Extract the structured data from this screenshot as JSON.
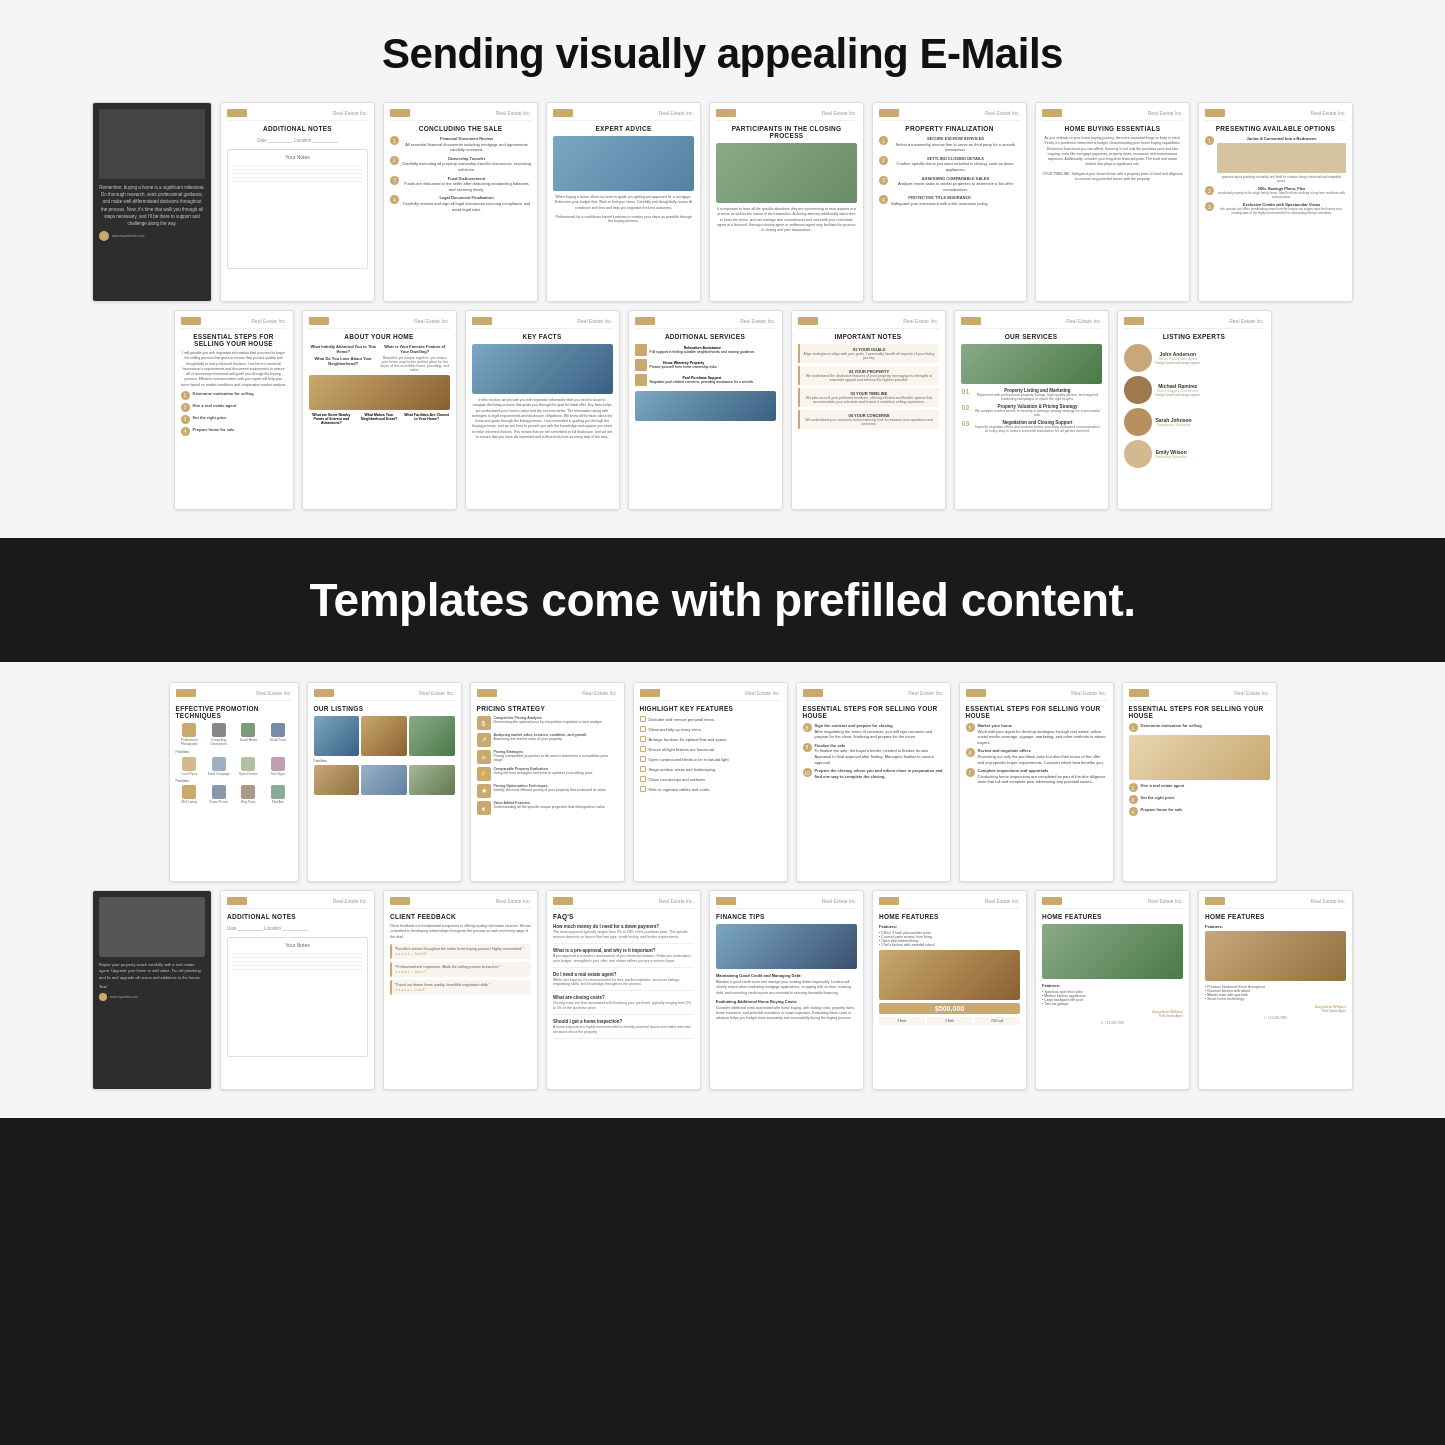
{
  "hero": {
    "title": "Sending visually appealing E-Mails"
  },
  "mid_banner": {
    "title": "Templates come with prefilled content."
  },
  "row1": {
    "cards": [
      {
        "id": "additional-notes-1",
        "title": "ADDITIONAL NOTES",
        "type": "notes"
      },
      {
        "id": "concluding-sale",
        "title": "CONCLUDING THE SALE",
        "type": "numbered"
      },
      {
        "id": "expert-advice",
        "title": "EXPERT ADVICE",
        "type": "text-image"
      },
      {
        "id": "participants-closing",
        "title": "PARTICIPANTS IN THE CLOSING PROCESS",
        "type": "text-image"
      },
      {
        "id": "property-finalization",
        "title": "PROPERTY FINALIZATION",
        "type": "numbered"
      },
      {
        "id": "home-buying-essentials",
        "title": "HOME BUYING ESSENTIALS",
        "type": "text-image"
      },
      {
        "id": "presenting-available",
        "title": "PRESENTING AVAILABLE OPTIONS",
        "type": "numbered"
      },
      {
        "id": "dark-intro",
        "title": "",
        "type": "dark-text"
      }
    ]
  },
  "row2": {
    "cards": [
      {
        "id": "essential-steps-1",
        "title": "ESSENTIAL STEPS FOR SELLING YOUR HOUSE",
        "type": "numbered"
      },
      {
        "id": "about-home",
        "title": "ABOUT YOUR HOME",
        "type": "about"
      },
      {
        "id": "key-facts",
        "title": "KEY FACTS",
        "type": "image-text"
      },
      {
        "id": "additional-services",
        "title": "ADDITIONAL SERVICES",
        "type": "services-list"
      },
      {
        "id": "important-notes",
        "title": "IMPORTANT NOTES",
        "type": "important"
      },
      {
        "id": "our-services",
        "title": "OUR SERVICES",
        "type": "services-numbered"
      },
      {
        "id": "listing-experts",
        "title": "LISTING EXPERTS",
        "type": "agents"
      }
    ]
  },
  "row3": {
    "cards": [
      {
        "id": "effective-promotion",
        "title": "EFFECTIVE PROMOTION TECHNIQUES",
        "type": "icon-grid"
      },
      {
        "id": "our-listings",
        "title": "OUR LISTINGS",
        "type": "listings"
      },
      {
        "id": "pricing-strategy",
        "title": "PRICING STRATEGY",
        "type": "pricing"
      },
      {
        "id": "highlight-features",
        "title": "HIGHLIGHT KEY FEATURES",
        "type": "checklist"
      },
      {
        "id": "essential-steps-2",
        "title": "ESSENTIAL STEPS FOR SELLING YOUR HOUSE",
        "type": "numbered-8"
      },
      {
        "id": "essential-steps-3",
        "title": "ESSENTIAL STEPS FOR SELLING YOUR HOUSE",
        "type": "numbered-5"
      },
      {
        "id": "essential-steps-4",
        "title": "ESSENTIAL STEPS FOR SELLING YOUR HOUSE",
        "type": "numbered-1"
      }
    ]
  },
  "row4": {
    "cards": [
      {
        "id": "dark-steps",
        "title": "",
        "type": "dark-numbered"
      },
      {
        "id": "additional-notes-2",
        "title": "ADDITIONAL NOTES",
        "type": "notes"
      },
      {
        "id": "client-feedback",
        "title": "CLIENT FEEDBACK",
        "type": "feedback"
      },
      {
        "id": "faqs",
        "title": "FAQ's",
        "type": "faq"
      },
      {
        "id": "finance-tips",
        "title": "FINANCE TIPS",
        "type": "finance"
      },
      {
        "id": "home-features-1",
        "title": "HOME FEATURES",
        "type": "home-feat"
      },
      {
        "id": "home-features-2",
        "title": "HOME FEATURES",
        "type": "home-feat2"
      },
      {
        "id": "home-features-3",
        "title": "HOME FEATURES",
        "type": "home-feat3"
      }
    ]
  },
  "agents": [
    {
      "name": "John Anderson",
      "role": "Senior Real Estate Agent",
      "color": "#c8a87a"
    },
    {
      "name": "Michael Ramirez",
      "role": "Home Staging Coordinator",
      "color": "#a07850"
    },
    {
      "name": "Sarah Johnson",
      "role": "Negotiation Specialist",
      "color": "#b89060"
    },
    {
      "name": "Emily Wilson",
      "role": "Marketing Specialist",
      "color": "#d4b890"
    }
  ],
  "colors": {
    "gold": "#c9a96e",
    "dark": "#1a1a1a",
    "light_bg": "#f5f5f5",
    "card_bg": "#ffffff",
    "text_dark": "#222222",
    "text_mid": "#555555",
    "text_light": "#888888"
  }
}
